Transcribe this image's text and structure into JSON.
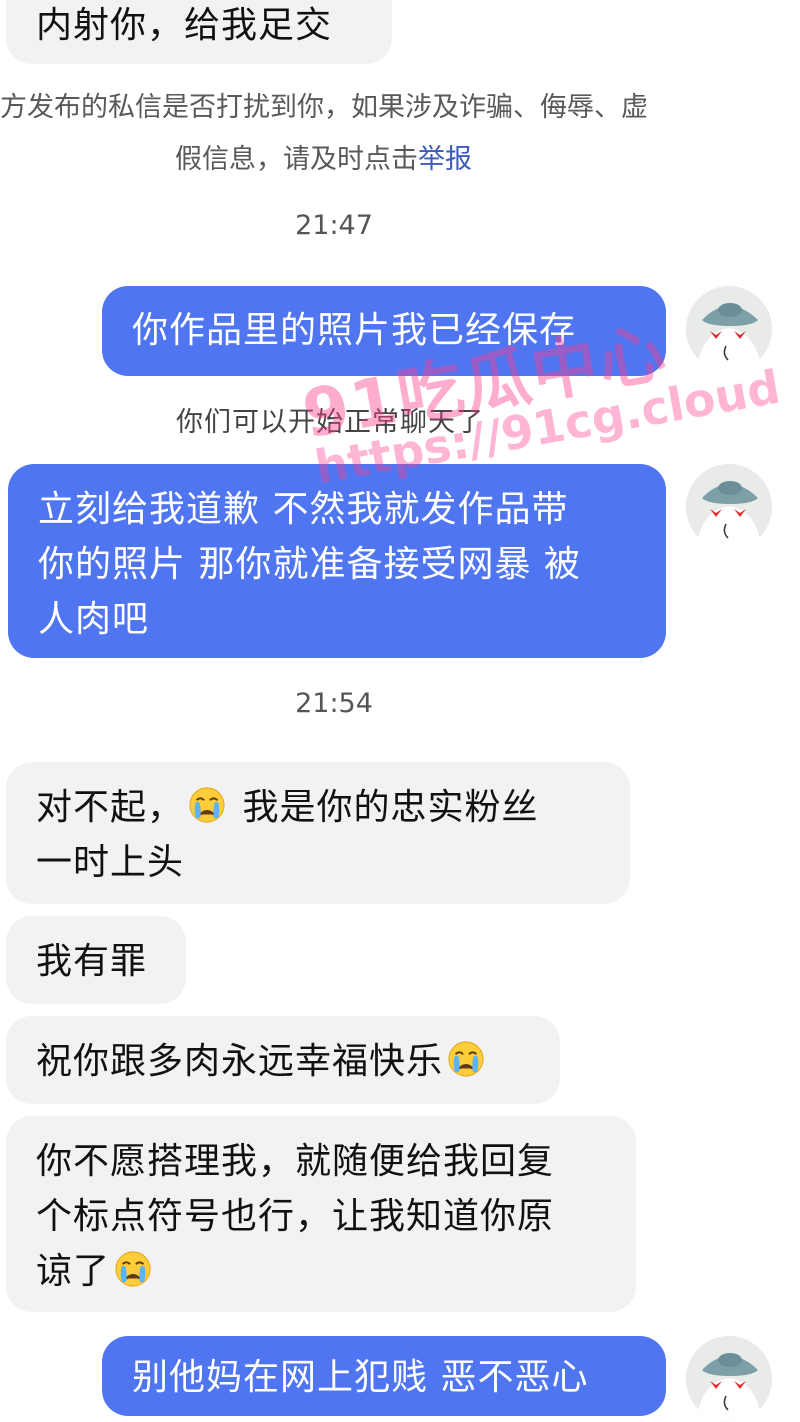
{
  "messages": {
    "top_partial": "内射你，给我足交",
    "notice_line1": "方发布的私信是否打扰到你，如果涉及诈骗、侮辱、虚",
    "notice_line2_prefix": "假信息，请及时点击",
    "notice_report_link": "举报",
    "time_1": "21:47",
    "out_1": "你作品里的照片我已经保存",
    "system_note": "你们可以开始正常聊天了",
    "out_2_line1": "立刻给我道歉 不然我就发作品带",
    "out_2_line2": "你的照片 那你就准备接受网暴 被",
    "out_2_line3": "人肉吧",
    "time_2": "21:54",
    "in_1_line1a": "对不起，",
    "in_1_line1b": "我是你的忠实粉丝",
    "in_1_line2": "一时上头",
    "in_2": "我有罪",
    "in_3": "祝你跟多肉永远幸福快乐",
    "in_4_line1": "你不愿搭理我，就随便给我回复",
    "in_4_line2": "个标点符号也行，让我知道你原",
    "in_4_line3": "谅了",
    "out_3_partial": "别他妈在网上犯贱 恶不恶心"
  },
  "watermark": {
    "title": "91吃瓜中心",
    "url": "https://91cg.cloud"
  },
  "icons": {
    "emoji": "crying-face-icon",
    "avatar": "cat-with-cap-avatar"
  },
  "colors": {
    "outgoing_bubble": "#4f76f0",
    "incoming_bubble": "#f2f2f4",
    "report_link": "#3d5bbb",
    "watermark": "#ff3c8c"
  }
}
